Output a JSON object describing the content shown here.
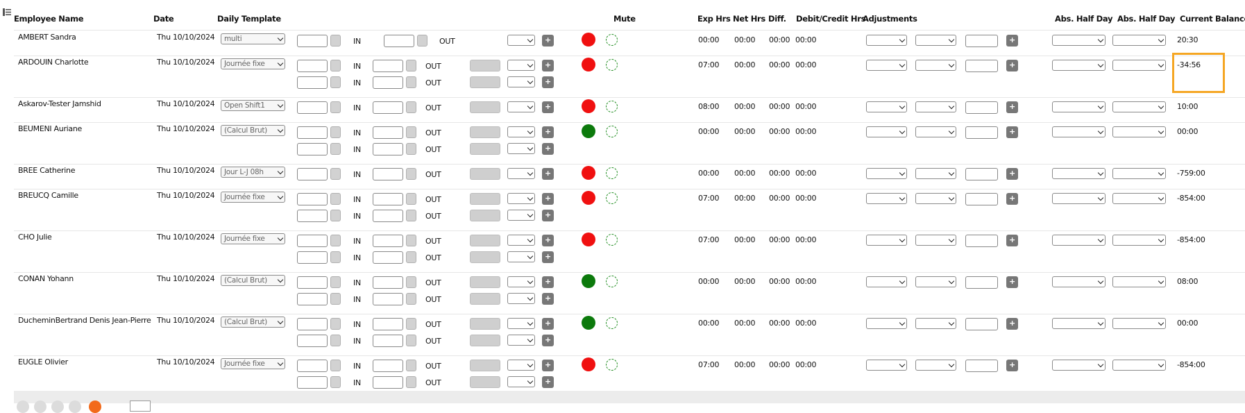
{
  "headers": {
    "employee_name": "Employee Name",
    "date": "Date",
    "daily_template": "Daily Template",
    "mute": "Mute",
    "exp_hrs": "Exp Hrs",
    "net_hrs": "Net Hrs",
    "diff": "Diff.",
    "debit_credit": "Debit/Credit Hrs",
    "adjustments": "Adjustments",
    "abs_half_day_1": "Abs. Half Day",
    "abs_half_day_2": "Abs. Half Day",
    "current_balance": "Current Balance"
  },
  "labels": {
    "in": "IN",
    "out": "OUT",
    "plus": "+"
  },
  "colors": {
    "status_red": "#f01010",
    "status_green": "#0c7a0c",
    "highlight": "#f5a623",
    "active_page": "#f26a1b"
  },
  "rows": [
    {
      "name": "AMBERT Sandra",
      "date": "Thu 10/10/2024",
      "template": "multi",
      "lines": 1,
      "status": "red",
      "exp": "00:00",
      "net": "00:00",
      "diff": "00:00",
      "debit": "00:00",
      "balance": "20:30",
      "stf": false
    },
    {
      "name": "ARDOUIN Charlotte",
      "date": "Thu 10/10/2024",
      "template": "Journée fixe",
      "lines": 2,
      "status": "red",
      "exp": "07:00",
      "net": "00:00",
      "diff": "00:00",
      "debit": "00:00",
      "balance": "-34:56",
      "stf": true
    },
    {
      "name": "Askarov-Tester Jamshid",
      "date": "Thu 10/10/2024",
      "template": "Open Shift1",
      "lines": 1,
      "status": "red",
      "exp": "08:00",
      "net": "00:00",
      "diff": "00:00",
      "debit": "00:00",
      "balance": "10:00",
      "stf": false
    },
    {
      "name": "BEUMENI Auriane",
      "date": "Thu 10/10/2024",
      "template": "(Calcul Brut)",
      "lines": 2,
      "status": "green",
      "exp": "00:00",
      "net": "00:00",
      "diff": "00:00",
      "debit": "00:00",
      "balance": "00:00",
      "stf": true
    },
    {
      "name": "BREE Catherine",
      "date": "Thu 10/10/2024",
      "template": "Jour L-J 08h",
      "lines": 1,
      "status": "red",
      "exp": "00:00",
      "net": "00:00",
      "diff": "00:00",
      "debit": "00:00",
      "balance": "-759:00",
      "stf": true
    },
    {
      "name": "BREUCQ Camille",
      "date": "Thu 10/10/2024",
      "template": "Journée fixe",
      "lines": 2,
      "status": "red",
      "exp": "07:00",
      "net": "00:00",
      "diff": "00:00",
      "debit": "00:00",
      "balance": "-854:00",
      "stf": false
    },
    {
      "name": "CHO Julie",
      "date": "Thu 10/10/2024",
      "template": "Journée fixe",
      "lines": 2,
      "status": "red",
      "exp": "07:00",
      "net": "00:00",
      "diff": "00:00",
      "debit": "00:00",
      "balance": "-854:00",
      "stf": false
    },
    {
      "name": "CONAN Yohann",
      "date": "Thu 10/10/2024",
      "template": "(Calcul Brut)",
      "lines": 2,
      "status": "green",
      "exp": "00:00",
      "net": "00:00",
      "diff": "00:00",
      "debit": "00:00",
      "balance": "08:00",
      "stf": false
    },
    {
      "name": "DucheminBertrand Denis Jean-Pierre",
      "date": "Thu 10/10/2024",
      "template": "(Calcul Brut)",
      "lines": 2,
      "status": "green",
      "exp": "00:00",
      "net": "00:00",
      "diff": "00:00",
      "debit": "00:00",
      "balance": "00:00",
      "stf": false
    },
    {
      "name": "EUGLE Olivier",
      "date": "Thu 10/10/2024",
      "template": "Journée fixe",
      "lines": 2,
      "status": "red",
      "exp": "07:00",
      "net": "00:00",
      "diff": "00:00",
      "debit": "00:00",
      "balance": "-854:00",
      "stf": true
    }
  ]
}
